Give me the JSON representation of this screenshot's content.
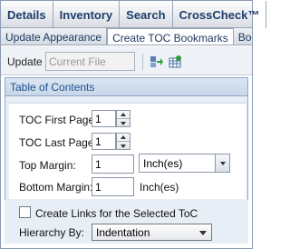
{
  "top_tabs": [
    "Details",
    "Inventory",
    "Search",
    "CrossCheck™"
  ],
  "sub_tabs": [
    {
      "label": "Update Appearance",
      "active": false
    },
    {
      "label": "Create TOC Bookmarks",
      "active": true
    },
    {
      "label": "Bookm",
      "active": false
    }
  ],
  "update": {
    "label": "Update",
    "placeholder": "Current File",
    "icons": [
      "arrow-right-icon",
      "refresh-grid-icon"
    ]
  },
  "panel": {
    "title": "Table of Contents",
    "toc_first_page": {
      "label": "TOC First Page:",
      "value": "1"
    },
    "toc_last_page": {
      "label": "TOC Last Page:",
      "value": "1"
    },
    "top_margin": {
      "label": "Top Margin:",
      "value": "1",
      "unit": "Inch(es)"
    },
    "bottom_margin": {
      "label": "Bottom Margin:",
      "value": "1",
      "unit": "Inch(es)"
    },
    "create_links": {
      "label": "Create Links for the Selected ToC",
      "checked": false
    },
    "hierarchy": {
      "label": "Hierarchy By:",
      "value": "Indentation"
    }
  }
}
